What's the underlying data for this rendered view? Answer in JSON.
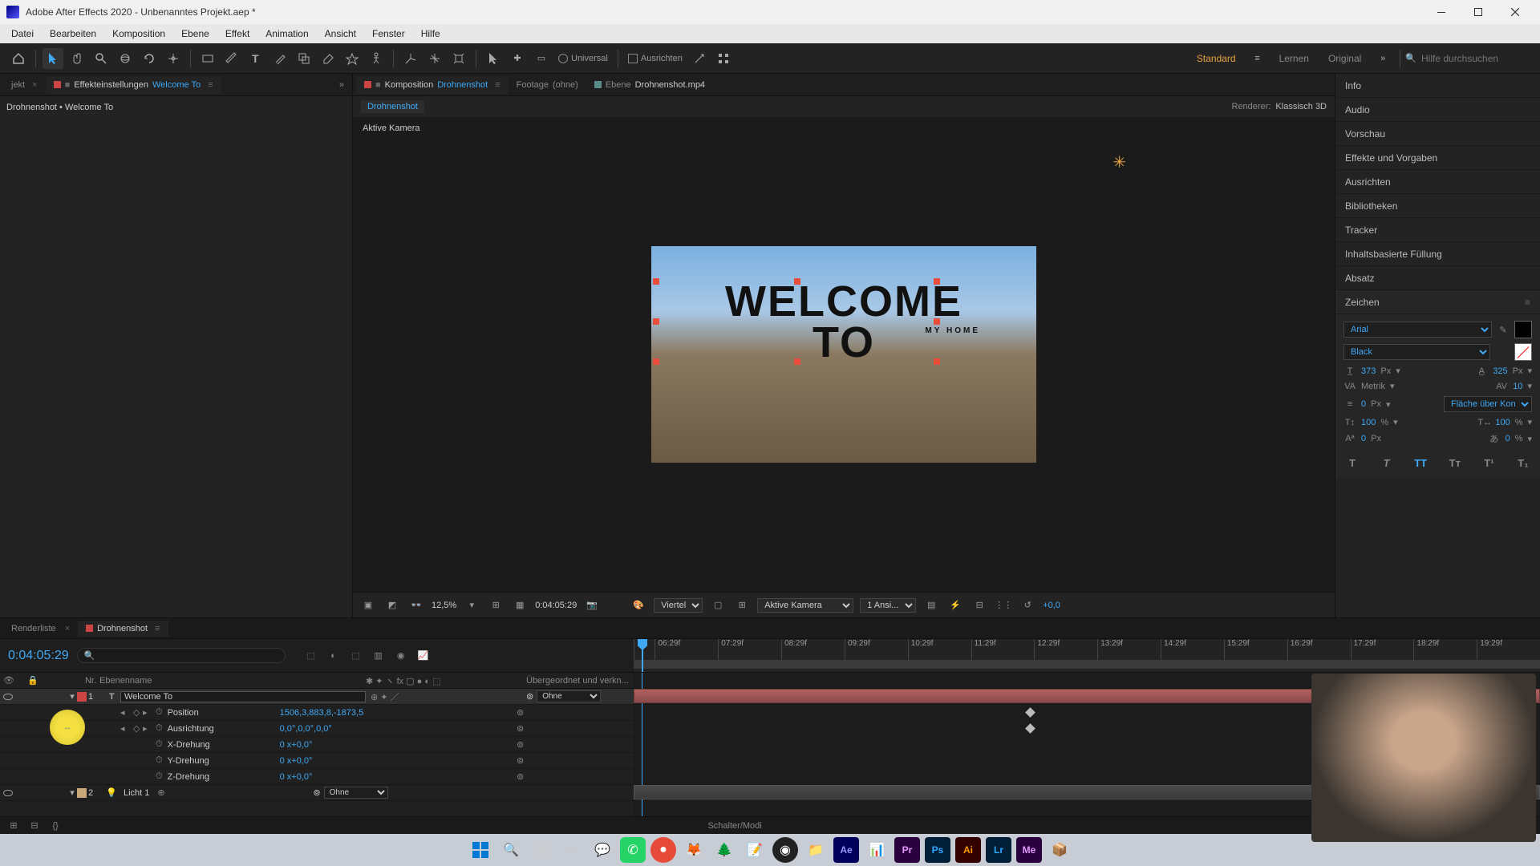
{
  "titlebar": {
    "title": "Adobe After Effects 2020 - Unbenanntes Projekt.aep *"
  },
  "menubar": {
    "items": [
      "Datei",
      "Bearbeiten",
      "Komposition",
      "Ebene",
      "Effekt",
      "Animation",
      "Ansicht",
      "Fenster",
      "Hilfe"
    ]
  },
  "toolbar": {
    "universal_label": "Universal",
    "ausrichten_label": "Ausrichten",
    "ws_standard": "Standard",
    "ws_lernen": "Lernen",
    "ws_original": "Original",
    "search_placeholder": "Hilfe durchsuchen"
  },
  "left_panel": {
    "tab_project": "jekt",
    "tab_effects": "Effekteinstellungen",
    "tab_effects_target": "Welcome To",
    "content_line": "Drohnenshot • Welcome To"
  },
  "center_panel": {
    "tab_footage": "Footage",
    "tab_footage_val": "(ohne)",
    "tab_comp": "Komposition",
    "tab_comp_target": "Drohnenshot",
    "tab_layer": "Ebene",
    "tab_layer_target": "Drohnenshot.mp4",
    "crumb": "Drohnenshot",
    "renderer_label": "Renderer:",
    "renderer_value": "Klassisch 3D",
    "camera_label": "Aktive Kamera",
    "preview_big1": "WELCOME",
    "preview_big2": "TO",
    "preview_small": "MY HOME",
    "footer": {
      "zoom": "12,5%",
      "timecode": "0:04:05:29",
      "res": "Viertel",
      "camera": "Aktive Kamera",
      "views": "1 Ansi...",
      "exposure": "+0,0"
    }
  },
  "right_panel": {
    "sections": [
      "Info",
      "Audio",
      "Vorschau",
      "Effekte und Vorgaben",
      "Ausrichten",
      "Bibliotheken",
      "Tracker",
      "Inhaltsbasierte Füllung",
      "Absatz",
      "Zeichen"
    ],
    "char": {
      "font": "Arial",
      "weight": "Black",
      "size": "373",
      "size_unit": "Px",
      "leading": "325",
      "leading_unit": "Px",
      "kerning": "Metrik",
      "tracking": "10",
      "stroke": "0",
      "stroke_unit": "Px",
      "stroke_mode": "Fläche über Kon...",
      "vscale": "100",
      "hscale": "100",
      "baseline": "0",
      "tsume": "0",
      "pct": "%"
    }
  },
  "timeline": {
    "tab_render": "Renderliste",
    "tab_comp": "Drohnenshot",
    "timecode": "0:04:05:29",
    "col_nr": "Nr.",
    "col_name": "Ebenenname",
    "col_parent": "Übergeordnet und verkn...",
    "ruler": [
      "06:29f",
      "07:29f",
      "08:29f",
      "09:29f",
      "10:29f",
      "11:29f",
      "12:29f",
      "13:29f",
      "14:29f",
      "15:29f",
      "16:29f",
      "17:29f",
      "18:29f",
      "19:29f"
    ],
    "layers": [
      {
        "nr": "1",
        "name": "Welcome To",
        "type": "T",
        "parent": "Ohne",
        "color": "red"
      },
      {
        "nr": "2",
        "name": "Licht 1",
        "type": "L",
        "parent": "Ohne",
        "color": "tan"
      }
    ],
    "props": [
      {
        "name": "Position",
        "val": "1506,3,883,8,-1873,5",
        "hasKf": true
      },
      {
        "name": "Ausrichtung",
        "val": "0,0°,0,0°,0,0°",
        "hasKf": true
      },
      {
        "name": "X-Drehung",
        "val": "0 x+0,0°",
        "hasKf": false
      },
      {
        "name": "Y-Drehung",
        "val": "0 x+0,0°",
        "hasKf": false
      },
      {
        "name": "Z-Drehung",
        "val": "0 x+0,0°",
        "hasKf": false
      }
    ],
    "footer_mode": "Schalter/Modi"
  }
}
